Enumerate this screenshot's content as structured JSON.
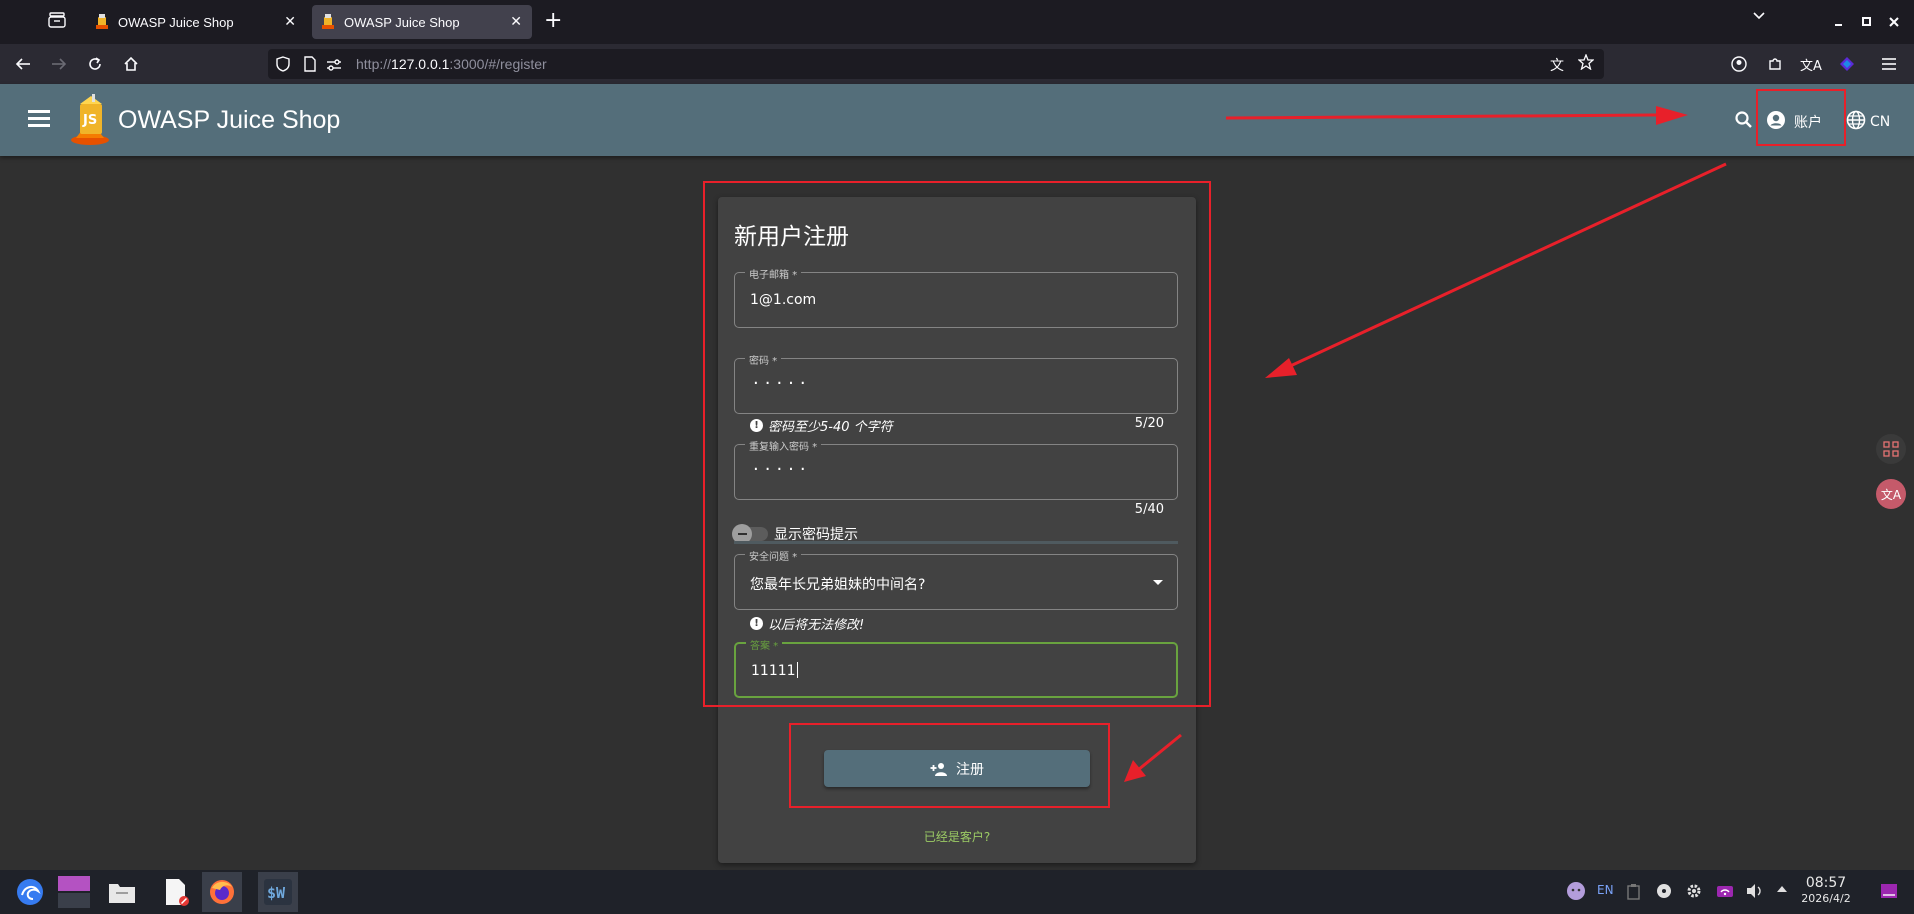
{
  "browser": {
    "tabs": [
      {
        "title": "OWASP Juice Shop",
        "active": false
      },
      {
        "title": "OWASP Juice Shop",
        "active": true
      }
    ],
    "url_scheme": "http://",
    "url_host": "127.0.0.1",
    "url_path": ":3000/#/register"
  },
  "app": {
    "title": "OWASP Juice Shop",
    "account_label": "账户",
    "language_label": "CN"
  },
  "form": {
    "title": "新用户注册",
    "email": {
      "label": "电子邮箱 *",
      "value": "1@1.com"
    },
    "password": {
      "label": "密码 *",
      "masked_value": "·····",
      "hint": "密码至少5-40 个字符",
      "counter": "5/20"
    },
    "repeat_password": {
      "label": "重复输入密码 *",
      "masked_value": "·····",
      "counter": "5/40"
    },
    "show_hint_toggle": {
      "label": "显示密码提示",
      "on": false
    },
    "security_question": {
      "label": "安全问题 *",
      "value": "您最年长兄弟姐妹的中间名?",
      "hint": "以后将无法修改!"
    },
    "answer": {
      "label": "答案 *",
      "value": "11111"
    },
    "register_button": "注册",
    "login_link": "已经是客户?"
  },
  "taskbar": {
    "tray_lang": "EN",
    "time": "08:57",
    "date": "2026/4/2"
  },
  "colors": {
    "toolbar": "#546e7a",
    "card": "#424242",
    "background": "#303030",
    "accent_green": "#69a33f",
    "annotation_red": "#e8202a"
  }
}
